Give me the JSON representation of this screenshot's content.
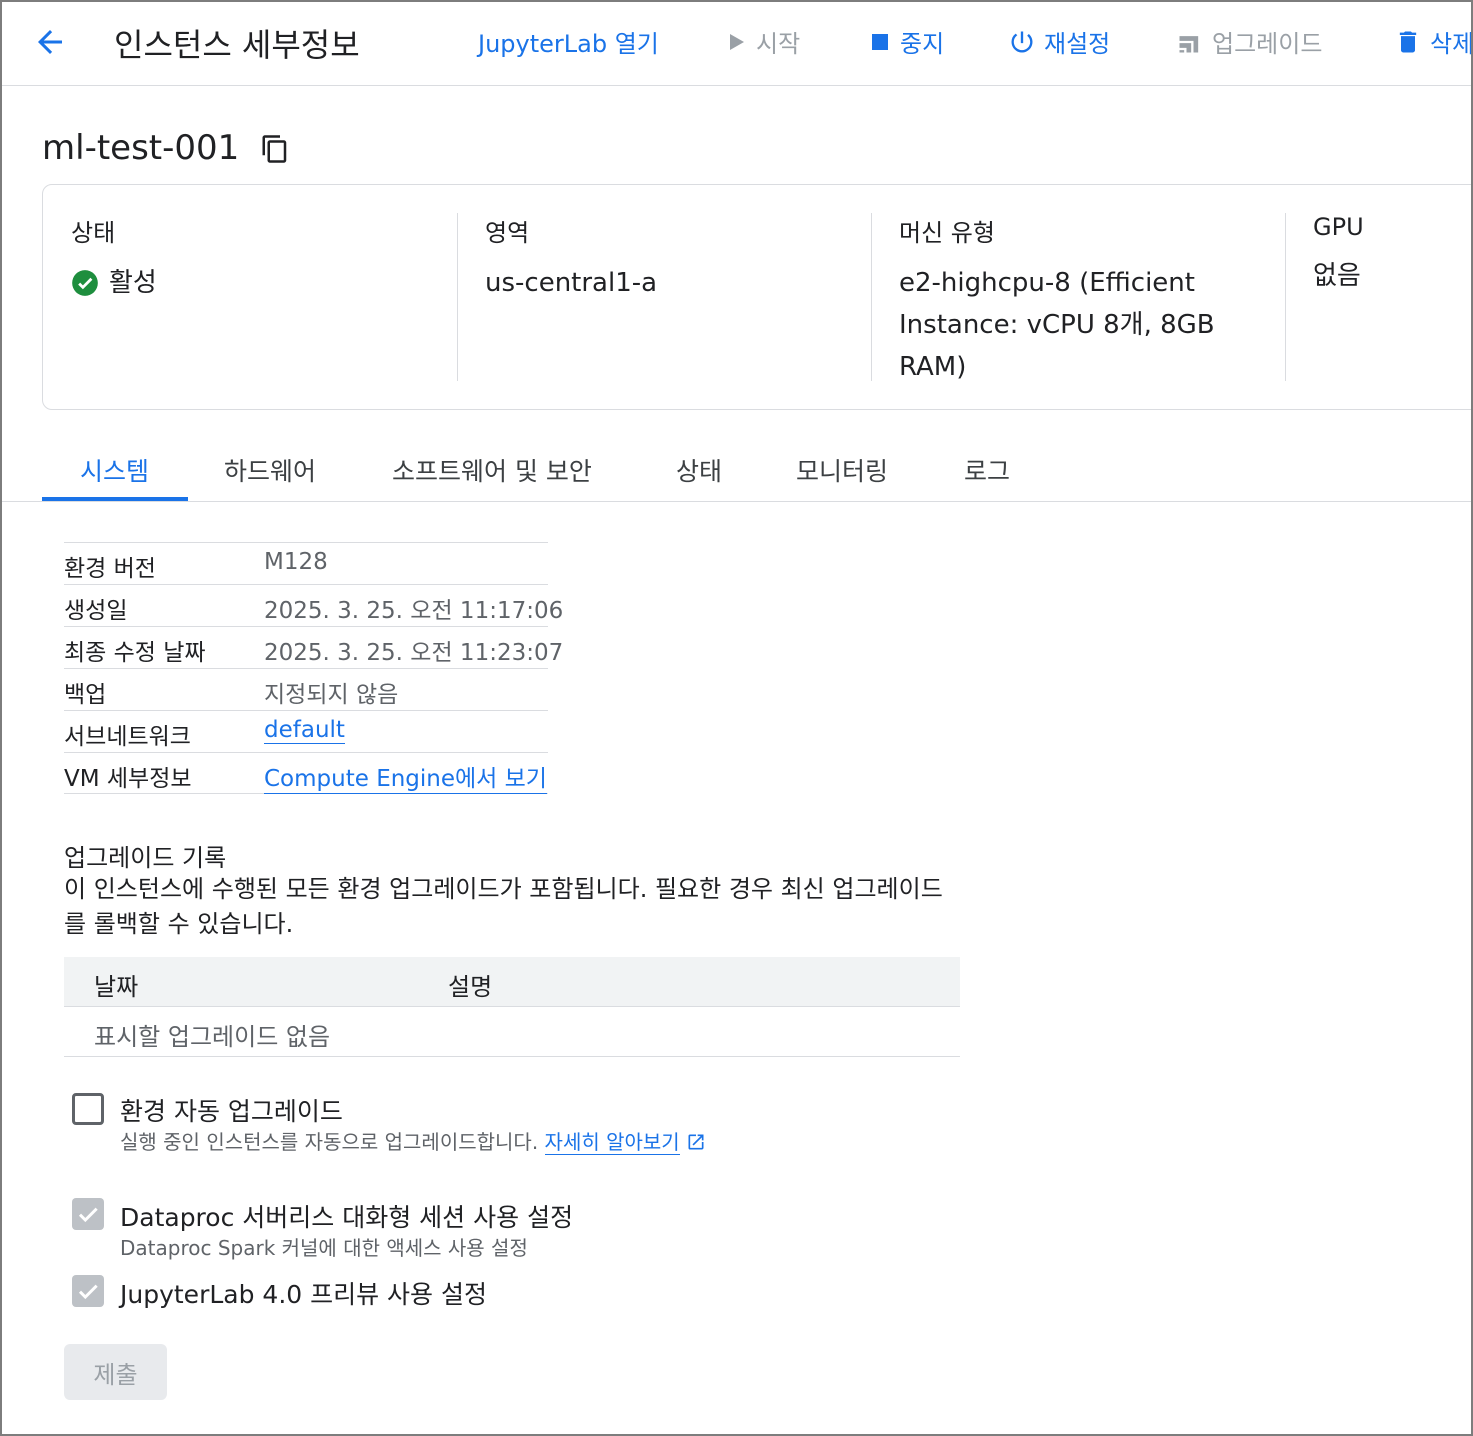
{
  "header": {
    "title": "인스턴스 세부정보",
    "actions": {
      "open_jupyterlab": "JupyterLab 열기",
      "start": "시작",
      "stop": "중지",
      "reset": "재설정",
      "upgrade": "업그레이드",
      "delete": "삭제"
    }
  },
  "instance": {
    "name": "ml-test-001"
  },
  "summary": {
    "status_label": "상태",
    "status_value": "활성",
    "zone_label": "영역",
    "zone_value": "us-central1-a",
    "machine_label": "머신 유형",
    "machine_value": "e2-highcpu-8 (Efficient Instance: vCPU 8개, 8GB RAM)",
    "gpu_label": "GPU",
    "gpu_value": "없음"
  },
  "tabs": [
    {
      "label": "시스템",
      "active": true
    },
    {
      "label": "하드웨어",
      "active": false
    },
    {
      "label": "소프트웨어 및 보안",
      "active": false
    },
    {
      "label": "상태",
      "active": false
    },
    {
      "label": "모니터링",
      "active": false
    },
    {
      "label": "로그",
      "active": false
    }
  ],
  "system": {
    "rows": [
      {
        "key": "환경 버전",
        "value": "M128"
      },
      {
        "key": "생성일",
        "value": "2025. 3. 25. 오전 11:17:06"
      },
      {
        "key": "최종 수정 날짜",
        "value": "2025. 3. 25. 오전 11:23:07"
      },
      {
        "key": "백업",
        "value": "지정되지 않음"
      },
      {
        "key": "서브네트워크",
        "value": "default"
      },
      {
        "key": "VM 세부정보",
        "value": "Compute Engine에서 보기"
      }
    ]
  },
  "upgrade_history": {
    "title": "업그레이드 기록",
    "description": "이 인스턴스에 수행된 모든 환경 업그레이드가 포함됩니다. 필요한 경우 최신 업그레이드를 롤백할 수 있습니다.",
    "col_date": "날짜",
    "col_desc": "설명",
    "empty": "표시할 업그레이드 없음"
  },
  "options": {
    "auto_upgrade_label": "환경 자동 업그레이드",
    "auto_upgrade_sub": "실행 중인 인스턴스를 자동으로 업그레이드합니다.",
    "learn_more": "자세히 알아보기",
    "dataproc_label": "Dataproc 서버리스 대화형 세션 사용 설정",
    "dataproc_sub": "Dataproc Spark 커널에 대한 액세스 사용 설정",
    "jupyterlab4_label": "JupyterLab 4.0 프리뷰 사용 설정"
  },
  "submit_label": "제출",
  "colors": {
    "accent": "#1a73e8",
    "success": "#1e8e3e",
    "disabled": "#9aa0a6"
  },
  "icons": [
    "arrow-back-icon",
    "play-icon",
    "stop-icon",
    "power-icon",
    "upgrade-icon",
    "trash-icon",
    "copy-icon",
    "check-circle-icon",
    "external-link-icon",
    "checkmark-icon"
  ]
}
